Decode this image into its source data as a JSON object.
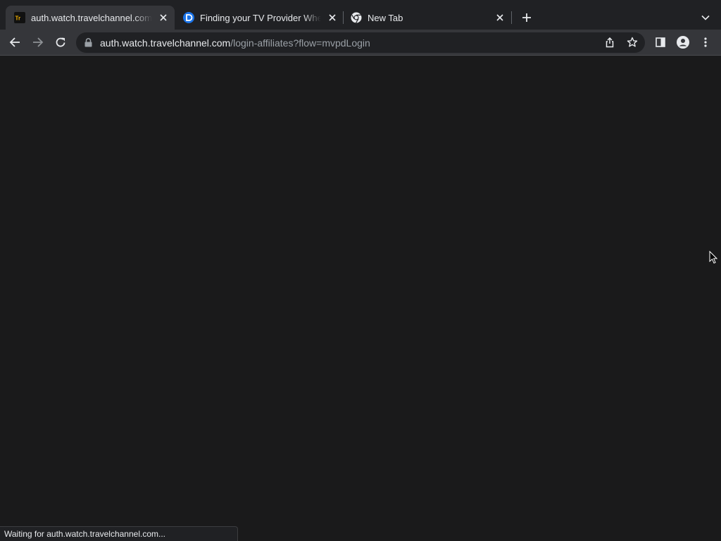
{
  "tabs": [
    {
      "title": "auth.watch.travelchannel.com/",
      "favicon": "travelchannel-favicon",
      "active": true
    },
    {
      "title": "Finding your TV Provider When",
      "favicon": "directv-favicon",
      "active": false
    },
    {
      "title": "New Tab",
      "favicon": "chrome-favicon",
      "active": false
    }
  ],
  "address": {
    "host": "auth.watch.travelchannel.com",
    "path": "/login-affiliates?flow=mvpdLogin"
  },
  "status": {
    "text": "Waiting for auth.watch.travelchannel.com..."
  },
  "favicon_text": {
    "travelchannel": "Tr"
  },
  "colors": {
    "accent_blue": "#1a73e8",
    "travel_orange": "#f5b301"
  }
}
